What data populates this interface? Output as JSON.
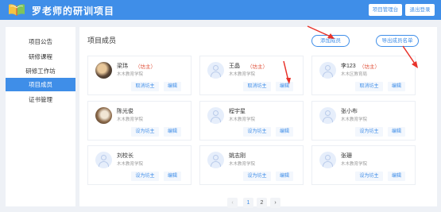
{
  "header": {
    "title": "罗老师的研训项目",
    "manage_label": "项目管理台",
    "logout_label": "退出登录"
  },
  "sidebar": {
    "items": [
      {
        "label": "项目公告",
        "active": false
      },
      {
        "label": "研修课程",
        "active": false
      },
      {
        "label": "研修工作坊",
        "active": false
      },
      {
        "label": "项目成员",
        "active": true
      },
      {
        "label": "证书管理",
        "active": false
      }
    ]
  },
  "main": {
    "title": "项目成员",
    "add_label": "添加成员",
    "export_label": "导出成员名单"
  },
  "members": [
    {
      "name": "梁玮",
      "role": "（坊主）",
      "org": "木木教育学院",
      "action": "取消坊主",
      "edit": "编辑",
      "avatar": "photo1"
    },
    {
      "name": "王晶",
      "role": "（坊主）",
      "org": "木木教育学院",
      "action": "取消坊主",
      "edit": "编辑",
      "avatar": "default"
    },
    {
      "name": "李123",
      "role": "（坊主）",
      "org": "木木区教育局",
      "action": "取消坊主",
      "edit": "编辑",
      "avatar": "default"
    },
    {
      "name": "陈光俊",
      "role": "",
      "org": "木木教育学院",
      "action": "设为坊主",
      "edit": "编辑",
      "avatar": "photo2"
    },
    {
      "name": "程宇星",
      "role": "",
      "org": "木木教育学院",
      "action": "设为坊主",
      "edit": "编辑",
      "avatar": "default"
    },
    {
      "name": "张小布",
      "role": "",
      "org": "木木教育学院",
      "action": "设为坊主",
      "edit": "编辑",
      "avatar": "default"
    },
    {
      "name": "刘校长",
      "role": "",
      "org": "木木教育学院",
      "action": "设为坊主",
      "edit": "编辑",
      "avatar": "default"
    },
    {
      "name": "姚志刚",
      "role": "",
      "org": "木木教育学院",
      "action": "设为坊主",
      "edit": "编辑",
      "avatar": "default"
    },
    {
      "name": "张珊",
      "role": "",
      "org": "木木教育学院",
      "action": "设为坊主",
      "edit": "编辑",
      "avatar": "default"
    }
  ],
  "pagination": {
    "prev": "‹",
    "pages": [
      "1",
      "2"
    ],
    "current": "1",
    "next": "›"
  },
  "colors": {
    "primary": "#3f8ee8",
    "role": "#e0523b",
    "annotation_arrow": "#e8322a"
  }
}
